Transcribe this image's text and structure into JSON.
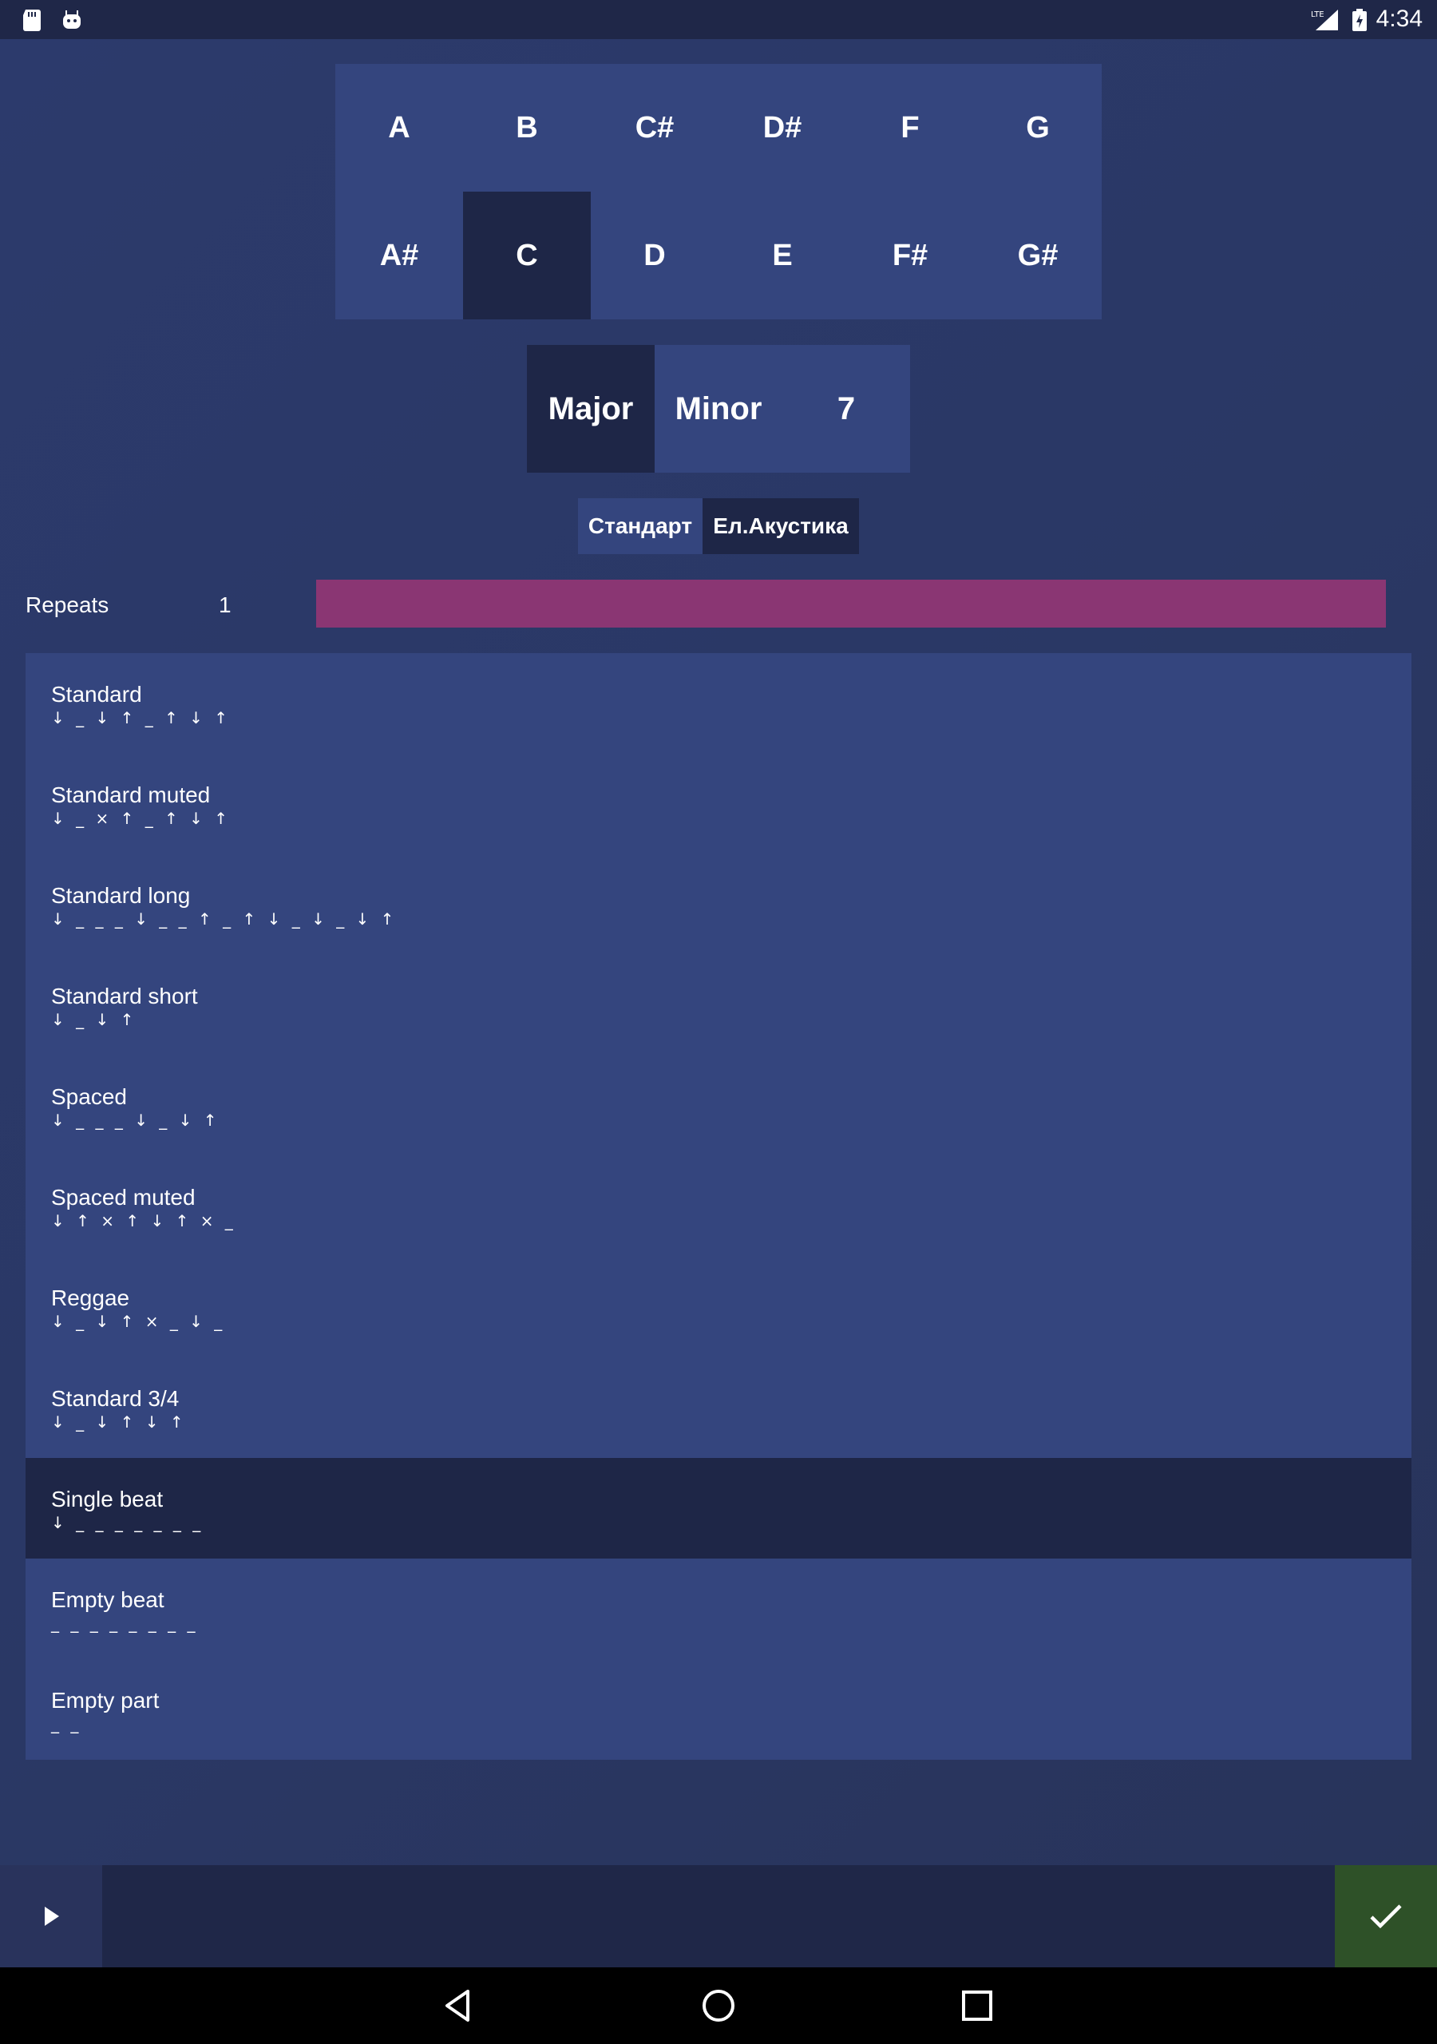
{
  "status_bar": {
    "time": "4:34",
    "icons": [
      "sd-card-icon",
      "android-icon",
      "lte-signal-icon",
      "battery-charging-icon"
    ]
  },
  "notes": {
    "row1": [
      "A",
      "B",
      "C#",
      "D#",
      "F",
      "G"
    ],
    "row2": [
      "A#",
      "C",
      "D",
      "E",
      "F#",
      "G#"
    ],
    "selected": "C"
  },
  "chord_types": {
    "items": [
      "Major",
      "Minor",
      "7"
    ],
    "selected": "Major"
  },
  "instruments": {
    "items": [
      "Стандарт",
      "Ел.Акустика"
    ],
    "selected": "Ел.Акустика"
  },
  "repeats": {
    "label": "Repeats",
    "value": "1"
  },
  "patterns": [
    {
      "name": "Standard",
      "sequence": "↓ _ ↓ ↑ _ ↑ ↓ ↑"
    },
    {
      "name": "Standard muted",
      "sequence": "↓ _ × ↑ _ ↑ ↓ ↑"
    },
    {
      "name": "Standard long",
      "sequence": "↓ _ _ _ ↓ _ _ ↑ _ ↑ ↓ _ ↓ _ ↓ ↑"
    },
    {
      "name": "Standard short",
      "sequence": "↓ _ ↓ ↑"
    },
    {
      "name": "Spaced",
      "sequence": "↓ _ _ _ ↓ _ ↓ ↑"
    },
    {
      "name": "Spaced muted",
      "sequence": "↓ ↑ × ↑ ↓ ↑ × _"
    },
    {
      "name": "Reggae",
      "sequence": "↓ _ ↓ ↑ × _ ↓ _"
    },
    {
      "name": "Standard 3/4",
      "sequence": "↓ _ ↓ ↑ ↓ ↑"
    },
    {
      "name": "Single beat",
      "sequence": "↓ _ _ _ _ _ _ _"
    },
    {
      "name": "Empty beat",
      "sequence": "_ _ _ _ _ _ _ _"
    },
    {
      "name": "Empty part",
      "sequence": "_ _"
    }
  ],
  "selected_pattern": "Single beat",
  "actions": {
    "play_icon": "play-icon",
    "confirm_icon": "check-icon"
  },
  "navigation": [
    "back-icon",
    "home-icon",
    "recents-icon"
  ],
  "colors": {
    "background": "#2b3867",
    "panel": "#34457e",
    "selected": "#1e2647",
    "repeats_bar": "#8a3673",
    "confirm": "#2e5128"
  }
}
